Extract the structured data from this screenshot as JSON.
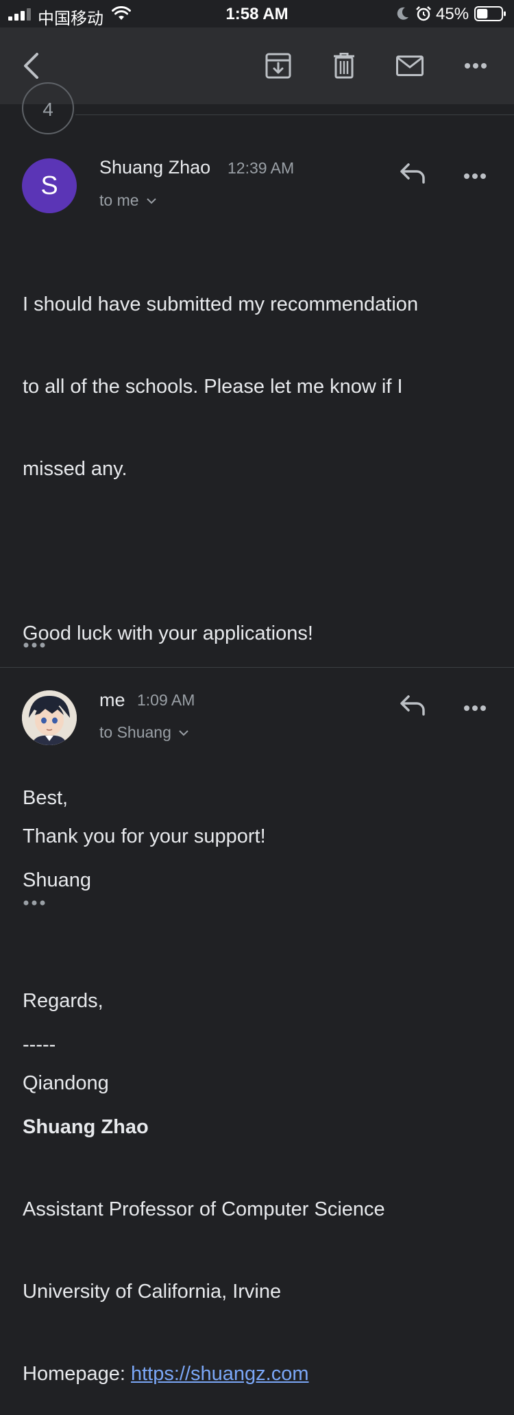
{
  "status_bar": {
    "carrier": "中国移动",
    "time": "1:58 AM",
    "battery_percent": "45%",
    "battery_level": 0.45,
    "icons": [
      "signal-icon",
      "wifi-icon",
      "moon-icon",
      "alarm-icon",
      "battery-icon"
    ]
  },
  "toolbar": {
    "icons": [
      "back-arrow-icon",
      "archive-icon",
      "trash-icon",
      "mail-icon",
      "more-icon"
    ]
  },
  "thread": {
    "collapsed_count": "4"
  },
  "messages": [
    {
      "avatar_letter": "S",
      "avatar_color": "#5b35b6",
      "sender": "Shuang Zhao",
      "time": "12:39 AM",
      "recipient": "to me",
      "body_lines": [
        "I should have submitted my recommendation",
        "to all of the schools. Please let me know if I",
        "missed any.",
        "",
        "Good luck with your applications!",
        "",
        "Best,",
        "Shuang",
        "",
        "-----"
      ],
      "signature": {
        "name": "Shuang Zhao",
        "title": "Assistant Professor of Computer Science",
        "org": "University of California, Irvine",
        "homepage_label": "Homepage: ",
        "homepage_url": "https://shuangz.com"
      }
    },
    {
      "sender": "me",
      "time": "1:09 AM",
      "recipient": "to Shuang",
      "body_lines": [
        "Thank you for your support!",
        "",
        "Regards,",
        "Qiandong"
      ]
    }
  ],
  "colors": {
    "background": "#202124",
    "toolbar": "#2d2e31",
    "link": "#7ba7f7",
    "secondary_text": "#9aa0a6"
  }
}
